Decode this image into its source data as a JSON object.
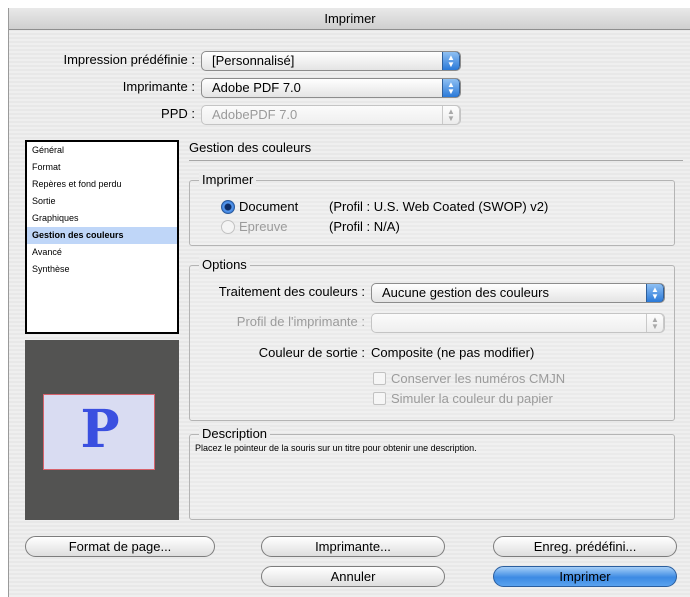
{
  "window": {
    "title": "Imprimer"
  },
  "preset": {
    "label": "Impression prédéfinie :",
    "value": "[Personnalisé]"
  },
  "printer": {
    "label": "Imprimante :",
    "value": "Adobe PDF 7.0"
  },
  "ppd": {
    "label": "PPD :",
    "value": "AdobePDF 7.0"
  },
  "sidebar": {
    "items": [
      {
        "label": "Général"
      },
      {
        "label": "Format"
      },
      {
        "label": "Repères et fond perdu"
      },
      {
        "label": "Sortie"
      },
      {
        "label": "Graphiques"
      },
      {
        "label": "Gestion des couleurs"
      },
      {
        "label": "Avancé"
      },
      {
        "label": "Synthèse"
      }
    ],
    "selected": "Gestion des couleurs"
  },
  "preview": {
    "letter": "P"
  },
  "panel": {
    "title": "Gestion des couleurs",
    "print_group": {
      "title": "Imprimer",
      "document_label": "Document",
      "document_profile": "(Profil : U.S. Web Coated (SWOP) v2)",
      "proof_label": "Epreuve",
      "proof_profile": "(Profil : N/A)"
    },
    "options": {
      "title": "Options",
      "color_handling_label": "Traitement des couleurs :",
      "color_handling_value": "Aucune gestion des couleurs",
      "printer_profile_label": "Profil de l'imprimante :",
      "printer_profile_value": "",
      "output_color_label": "Couleur de sortie :",
      "output_color_value": "Composite (ne pas modifier)",
      "preserve_cmyk_label": "Conserver les numéros CMJN",
      "simulate_paper_label": "Simuler la couleur du papier"
    },
    "description": {
      "title": "Description",
      "text": "Placez le pointeur de la souris sur un titre pour obtenir une description."
    }
  },
  "buttons": {
    "page_setup": "Format de page...",
    "printer": "Imprimante...",
    "save_preset": "Enreg. prédéfini...",
    "cancel": "Annuler",
    "print": "Imprimer"
  },
  "colors": {
    "accent": "#3c8ae3",
    "selection": "#bfd6f8",
    "preview_bg": "#535352",
    "preview_letter": "#3a4fe0"
  }
}
